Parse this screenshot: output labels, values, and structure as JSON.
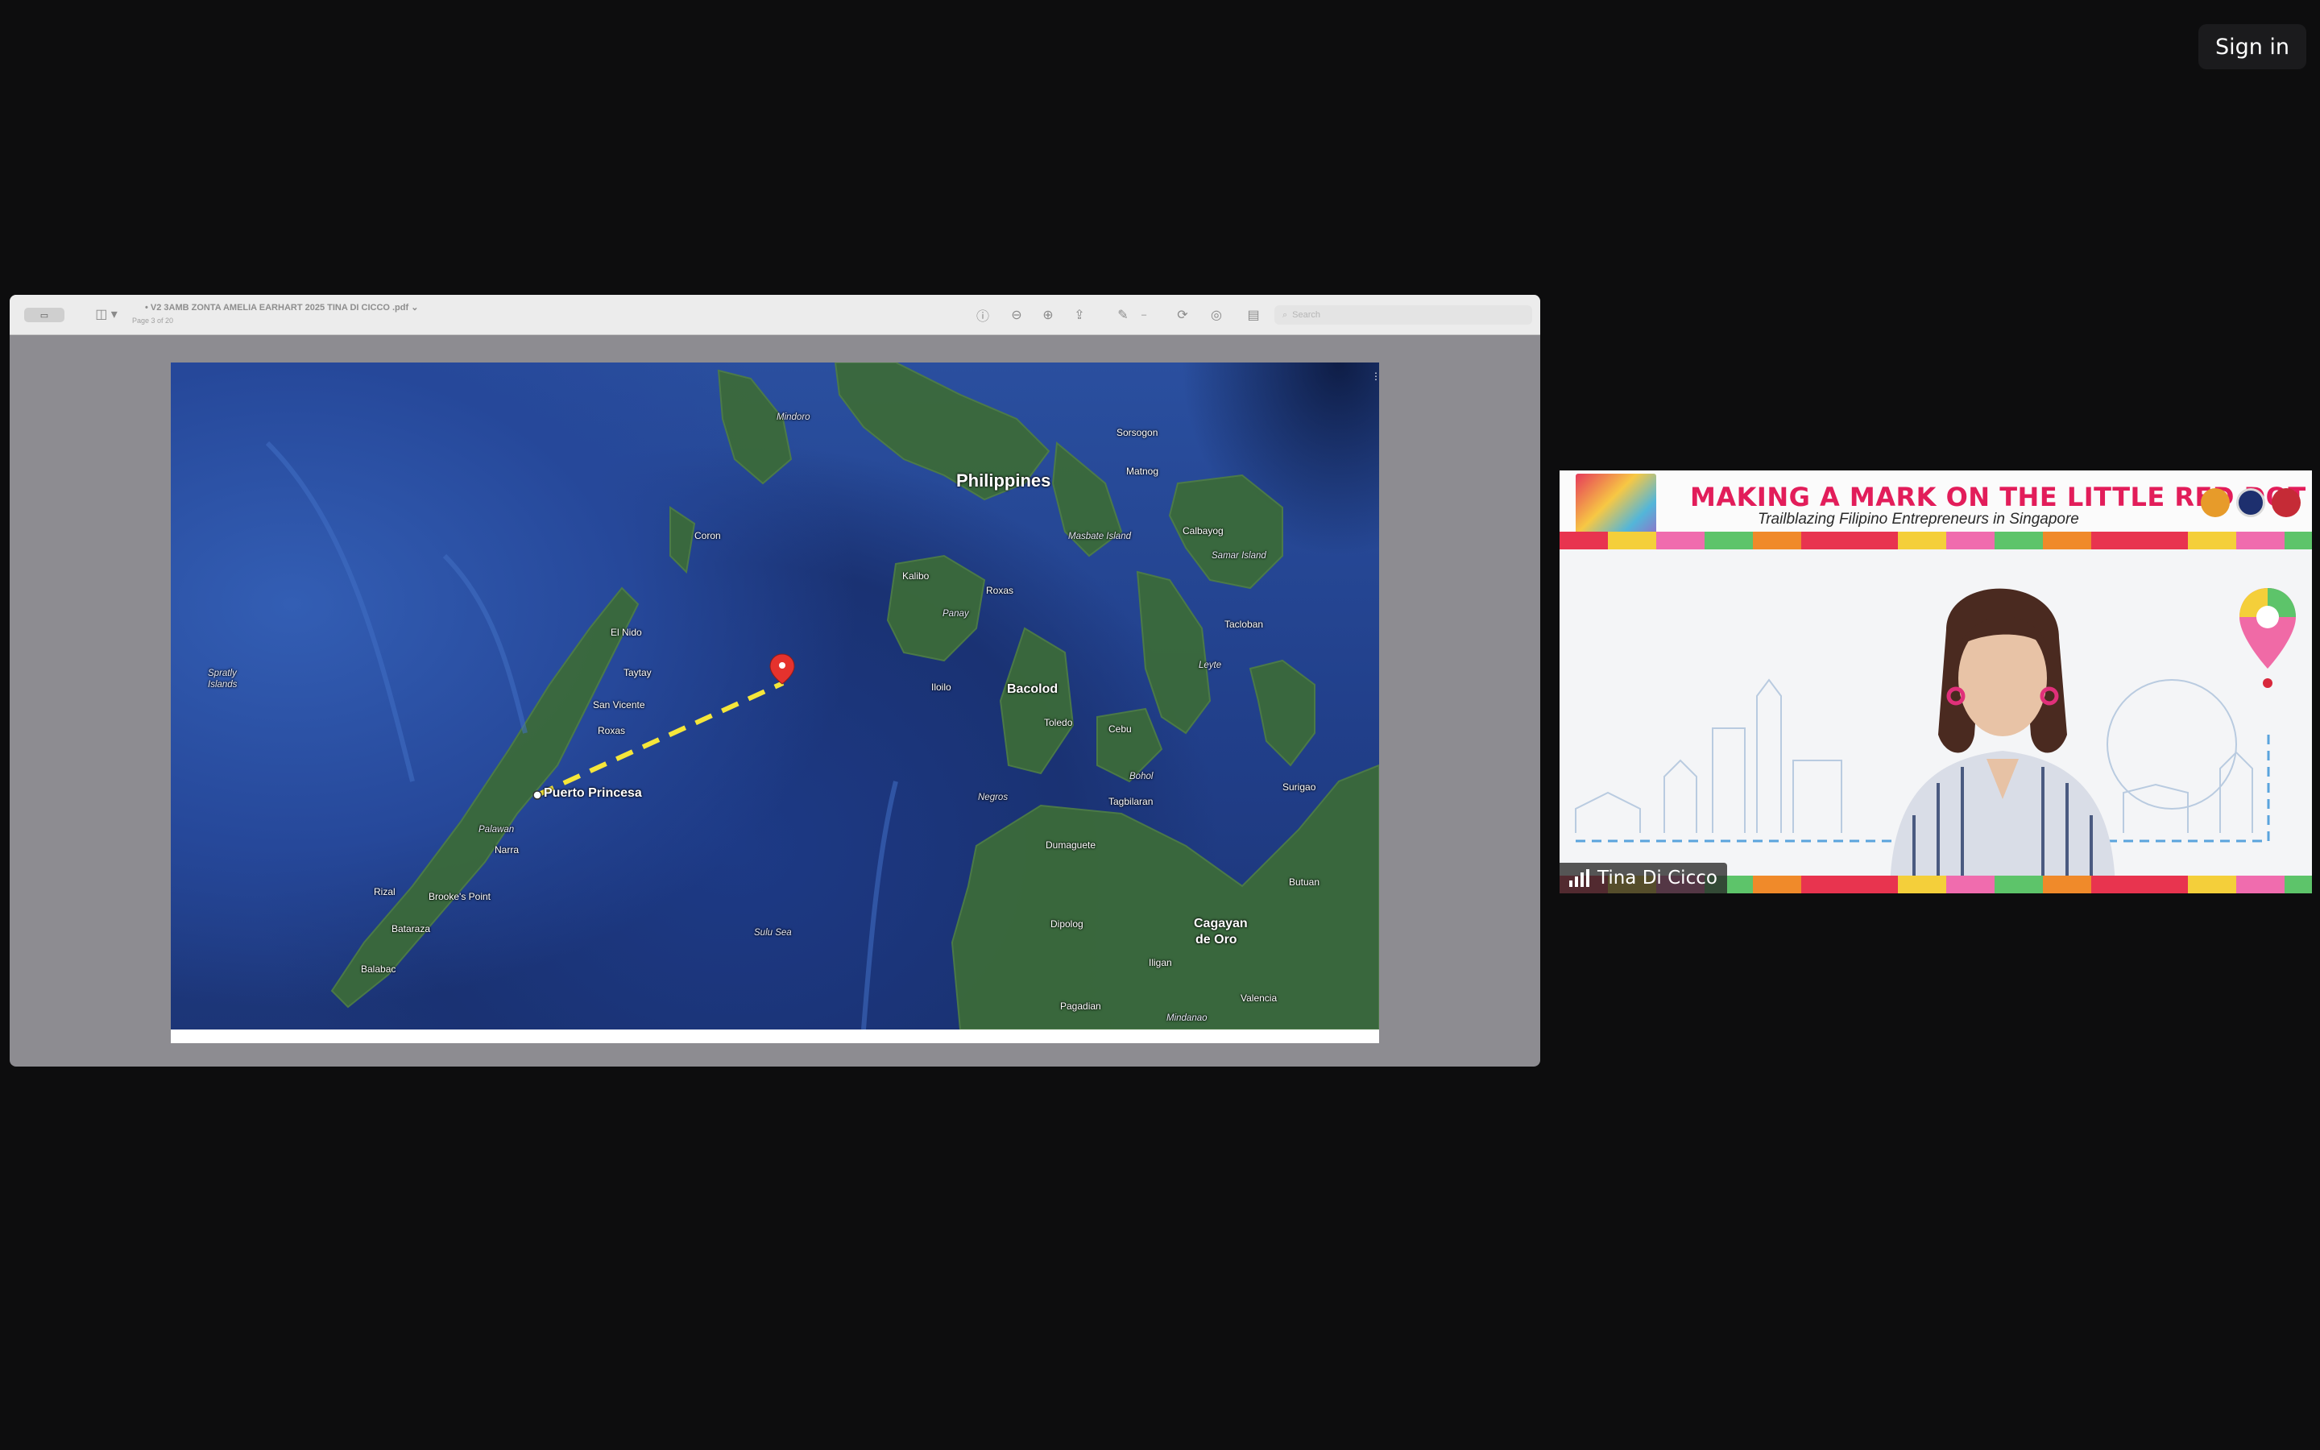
{
  "header": {
    "sign_in_label": "Sign in"
  },
  "pdf_viewer": {
    "document_title": "V2 3AMB ZONTA AMELIA EARHART 2025 TINA DI CICCO .pdf",
    "page_indicator": "Page 3 of 20",
    "search_placeholder": "Search"
  },
  "map": {
    "country_label": "Philippines",
    "major_labels": [
      "Puerto Princesa",
      "Bacolod",
      "Cagayan",
      "de Oro"
    ],
    "places": [
      "Mindoro",
      "Sorsogon",
      "Matnog",
      "Coron",
      "Calbayog",
      "Masbate Island",
      "Samar Island",
      "Kalibo",
      "Roxas",
      "Panay",
      "El Nido",
      "Tacloban",
      "Leyte",
      "Taytay",
      "Iloilo",
      "Spratly",
      "Islands",
      "San Vicente",
      "Toledo",
      "Cebu",
      "Roxas",
      "Bohol",
      "Tagbilaran",
      "Negros",
      "Surigao",
      "Palawan",
      "Dumaguete",
      "Narra",
      "Butuan",
      "Rizal",
      "Brooke's Point",
      "Dipolog",
      "Bataraza",
      "Sulu Sea",
      "Iligan",
      "Balabac",
      "Valencia",
      "Pagadian",
      "Mindanao"
    ],
    "route_color": "#f5e63a",
    "marker_color": "#e5322d"
  },
  "video": {
    "banner_title": "MAKING A MARK ON THE LITTLE RED DOT",
    "banner_subtitle": "Trailblazing  Filipino Entrepreneurs in Singapore",
    "participant_name": "Tina Di Cicco"
  }
}
